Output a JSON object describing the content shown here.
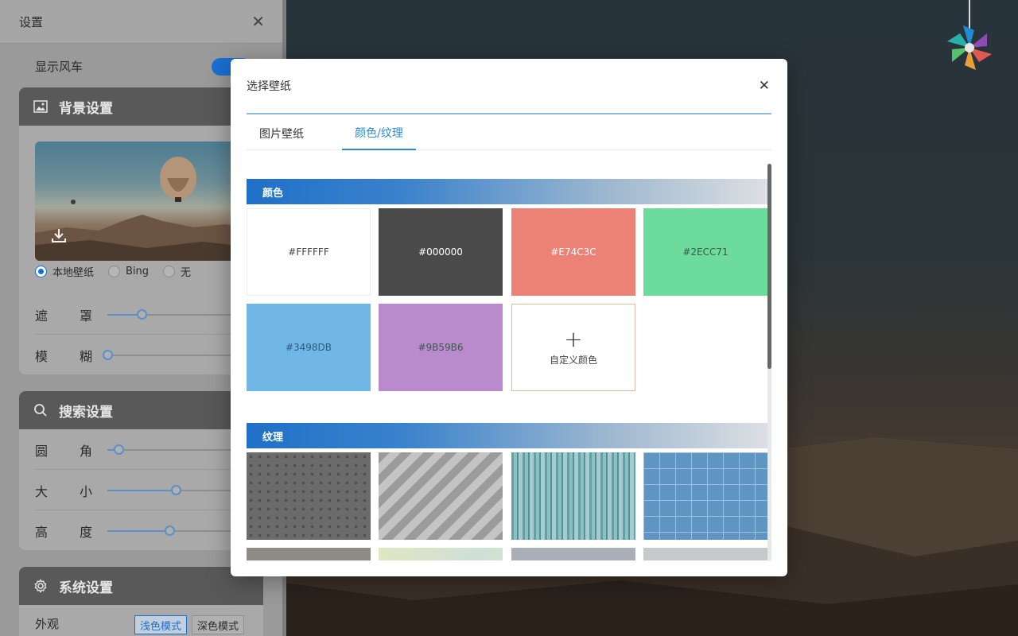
{
  "panel": {
    "title": "设置",
    "windmill_label": "显示风车",
    "background_section": {
      "title": "背景设置",
      "radios": [
        {
          "label": "本地壁纸",
          "checked": true
        },
        {
          "label": "Bing",
          "checked": false
        },
        {
          "label": "无",
          "checked": false
        }
      ],
      "sliders": [
        {
          "label": [
            "遮",
            "罩"
          ],
          "value": 0.22
        },
        {
          "label": [
            "模",
            "糊"
          ],
          "value": 0.0
        }
      ]
    },
    "search_section": {
      "title": "搜索设置",
      "sliders": [
        {
          "label": [
            "圆",
            "角"
          ],
          "value": 0.07
        },
        {
          "label": [
            "大",
            "小"
          ],
          "value": 0.44
        },
        {
          "label": [
            "高",
            "度"
          ],
          "value": 0.4
        }
      ]
    },
    "system_section": {
      "title": "系统设置",
      "appearance_label": "外观",
      "modes": [
        "浅色模式",
        "深色模式"
      ]
    }
  },
  "modal": {
    "title": "选择壁纸",
    "tabs": [
      {
        "label": "图片壁纸",
        "active": false
      },
      {
        "label": "颜色/纹理",
        "active": true
      }
    ],
    "color_section_title": "颜色",
    "colors": [
      {
        "label": "#FFFFFF",
        "hex": "#FFFFFF"
      },
      {
        "label": "#000000",
        "hex": "#4A4A4A"
      },
      {
        "label": "#E74C3C",
        "hex": "#EC8175"
      },
      {
        "label": "#2ECC71",
        "hex": "#6DDB9C"
      },
      {
        "label": "#3498DB",
        "hex": "#71B7E6"
      },
      {
        "label": "#9B59B6",
        "hex": "#B98BCD"
      }
    ],
    "custom_color_label": "自定义颜色",
    "texture_section_title": "纹理"
  }
}
